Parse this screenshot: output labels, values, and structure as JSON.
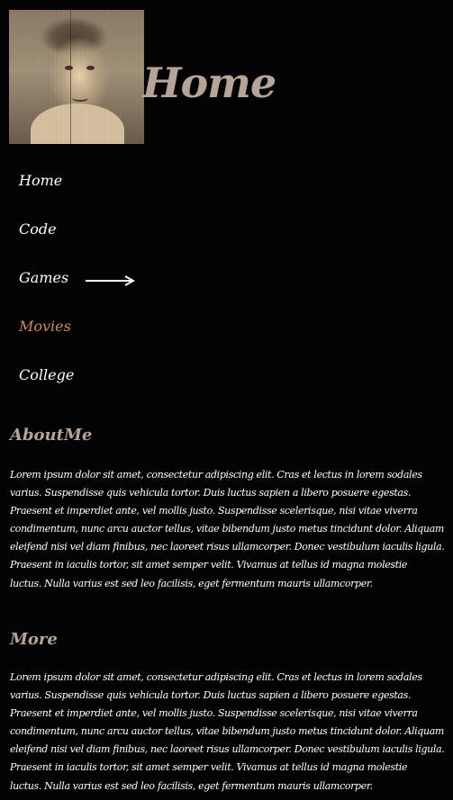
{
  "page": {
    "title": "Home"
  },
  "nav": {
    "items": [
      {
        "label": "Home"
      },
      {
        "label": "Code"
      },
      {
        "label": "Games"
      },
      {
        "label": "Movies"
      },
      {
        "label": "College"
      }
    ],
    "active_index": 3
  },
  "sections": {
    "about": {
      "heading": "AboutMe",
      "text": "Lorem ipsum dolor sit amet, consectetur adipiscing elit. Cras et lectus in lorem sodales\nvarius. Suspendisse quis vehicula tortor. Duis luctus sapien a libero posuere egestas.\nPraesent et imperdiet ante, vel mollis justo. Suspendisse scelerisque, nisi vitae viverra\ncondimentum, nunc arcu auctor tellus, vitae bibendum justo metus tincidunt dolor. Aliquam\neleifend nisi vel diam finibus, nec laoreet risus ullamcorper. Donec vestibulum iaculis ligula.\nPraesent in iaculis tortor, sit amet semper velit. Vivamus at tellus id magna molestie\nluctus. Nulla varius est sed leo facilisis, eget fermentum mauris ullamcorper."
    },
    "more": {
      "heading": "More",
      "text": "Lorem ipsum dolor sit amet, consectetur adipiscing elit. Cras et lectus in lorem sodales\nvarius. Suspendisse quis vehicula tortor. Duis luctus sapien a libero posuere egestas.\nPraesent et imperdiet ante, vel mollis justo. Suspendisse scelerisque, nisi vitae viverra\ncondimentum, nunc arcu auctor tellus, vitae bibendum justo metus tincidunt dolor. Aliquam\neleifend nisi vel diam finibus, nec laoreet risus ullamcorper. Donec vestibulum iaculis ligula.\nPraesent in iaculis tortor, sit amet semper velit. Vivamus at tellus id magna molestie\nluctus. Nulla varius est sed leo facilisis, eget fermentum mauris ullamcorper."
    }
  },
  "colors": {
    "background": "#030305",
    "accent": "#b5a497",
    "active_link": "#cd8b5f",
    "text": "#ffffff"
  },
  "icons": {
    "avatar": "profile-photo",
    "arrow": "arrow-right-icon"
  }
}
